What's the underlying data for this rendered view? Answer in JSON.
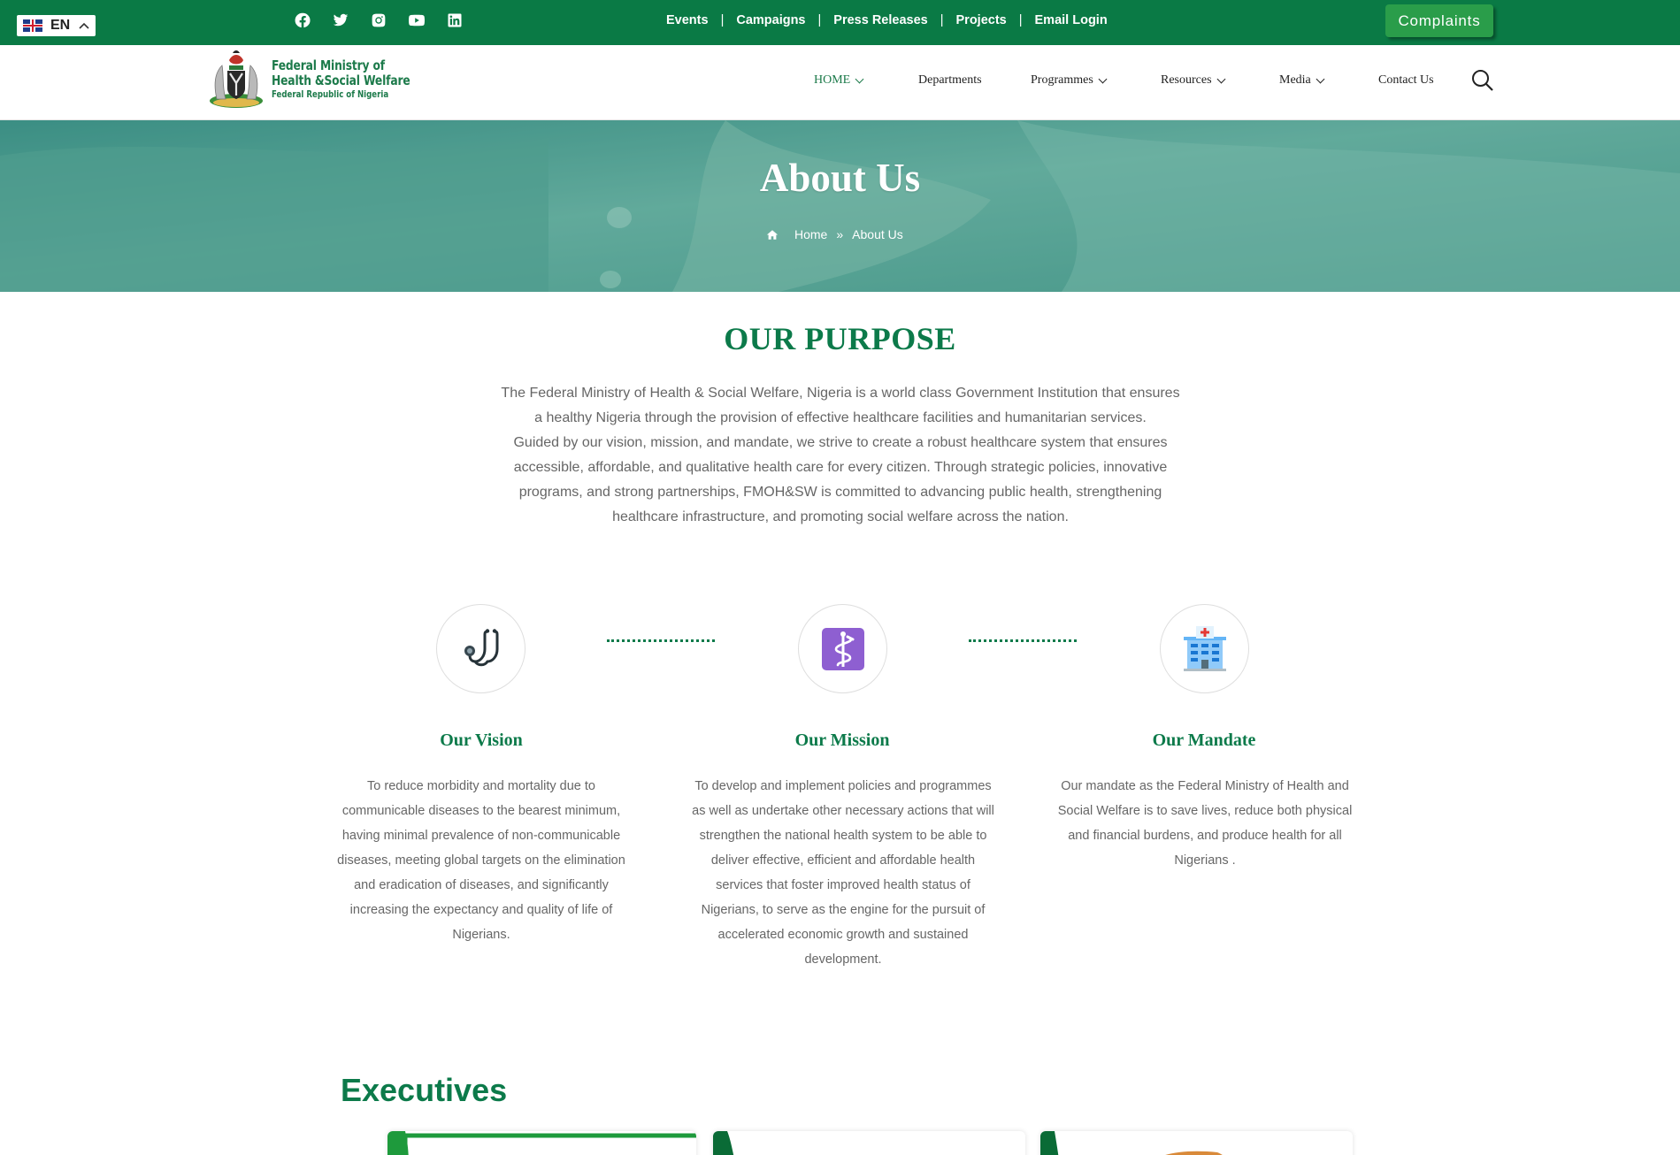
{
  "topbar": {
    "language": {
      "code": "EN",
      "flag": "uk-flag-icon"
    },
    "socials": [
      "facebook-icon",
      "twitter-icon",
      "instagram-icon",
      "youtube-icon",
      "linkedin-icon"
    ],
    "links": [
      "Events",
      "Campaigns",
      "Press Releases",
      "Projects",
      "Email Login"
    ],
    "separator": "|",
    "complaints_label": "Complaints"
  },
  "logo": {
    "line1": "Federal Ministry of",
    "line2": "Health &Social Welfare",
    "line3": "Federal Republic of Nigeria"
  },
  "nav": {
    "items": [
      {
        "label": "HOME",
        "dropdown": true,
        "active": true
      },
      {
        "label": "Departments",
        "dropdown": false
      },
      {
        "label": "Programmes",
        "dropdown": true
      },
      {
        "label": "Resources",
        "dropdown": true
      },
      {
        "label": "Media",
        "dropdown": true
      },
      {
        "label": "Contact Us",
        "dropdown": false
      }
    ],
    "search_icon": "search-icon"
  },
  "hero": {
    "title": "About Us",
    "breadcrumb": {
      "home": "Home",
      "separator": "»",
      "current": "About Us"
    }
  },
  "purpose": {
    "title": "OUR PURPOSE",
    "paragraph1": "The Federal Ministry of Health & Social Welfare, Nigeria is a world class Government Institution that ensures a healthy Nigeria through the provision of effective healthcare facilities and humanitarian services.",
    "paragraph2": "Guided by our vision, mission, and mandate, we strive to create a robust healthcare system that ensures accessible, affordable, and qualitative health care for every citizen. Through strategic policies, innovative programs, and strong partnerships, FMOH&SW is committed to advancing public health, strengthening healthcare infrastructure, and promoting social welfare across the nation."
  },
  "features": [
    {
      "icon": "stethoscope-icon",
      "title": "Our Vision",
      "text": "To reduce morbidity and mortality due to communicable diseases to the bearest minimum, having minimal prevalence of non-communicable diseases, meeting global targets on the elimination and eradication of diseases, and significantly increasing the expectancy and quality of life of Nigerians."
    },
    {
      "icon": "medical-caduceus-icon",
      "title": "Our Mission",
      "text": "To develop and implement policies and programmes as well as undertake other necessary actions that will strengthen the national health system to be able to deliver effective, efficient and affordable health services that foster improved health status of Nigerians, to serve as the engine for the pursuit of accelerated economic growth and sustained development."
    },
    {
      "icon": "hospital-icon",
      "title": "Our Mandate",
      "text": "Our mandate as the Federal Ministry of Health and Social Welfare is to save lives, reduce both physical and financial burdens, and produce health for all Nigerians ."
    }
  ],
  "executives": {
    "title": "Executives"
  },
  "colors": {
    "primary_green": "#0a7a45",
    "heading_green": "#0c7a4a",
    "complaints_button": "#2a9d4a",
    "hero_overlay": "#5fa89a"
  }
}
